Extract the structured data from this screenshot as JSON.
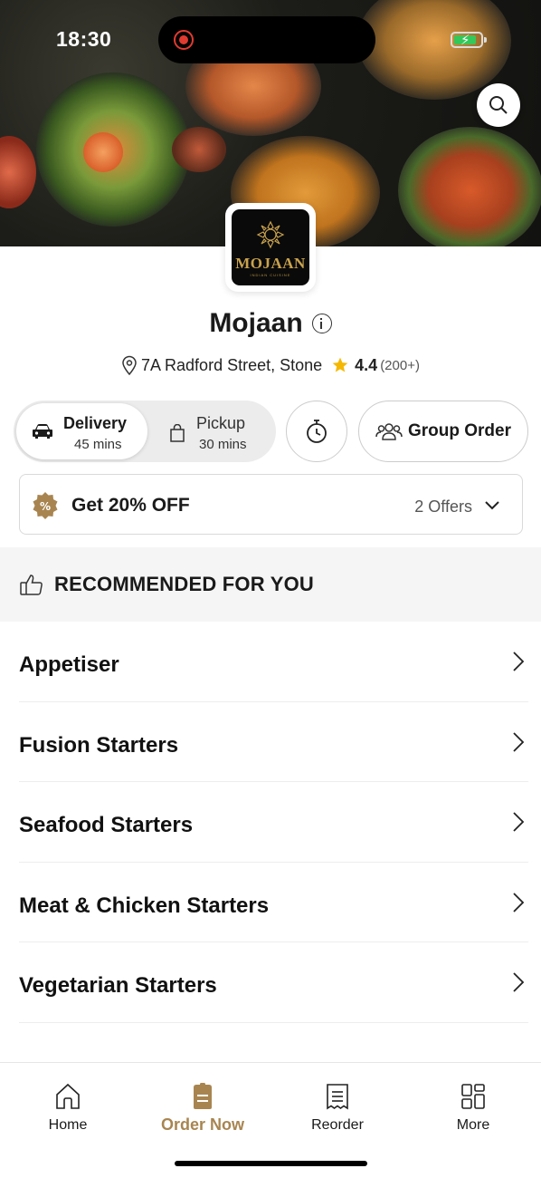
{
  "status_bar": {
    "time": "18:30",
    "battery_color": "#34c759",
    "battery_level": 0.85
  },
  "header": {
    "search_icon": "search-icon"
  },
  "restaurant": {
    "logo_text": "MOJAAN",
    "logo_subtext": "INDIAN CUISINE",
    "name": "Mojaan",
    "address": "7A Radford Street, Stone",
    "rating": "4.4",
    "reviews": "(200+)"
  },
  "order_mode": {
    "delivery_label": "Delivery",
    "delivery_time": "45 mins",
    "pickup_label": "Pickup",
    "pickup_time": "30 mins",
    "selected": "Delivery",
    "group_order_label": "Group Order"
  },
  "offers": {
    "title": "Get 20% OFF",
    "count": "2 Offers"
  },
  "recommended": {
    "title": "RECOMMENDED FOR YOU"
  },
  "categories": [
    {
      "label": "Appetiser"
    },
    {
      "label": "Fusion Starters"
    },
    {
      "label": "Seafood Starters"
    },
    {
      "label": "Meat & Chicken Starters"
    },
    {
      "label": "Vegetarian Starters"
    }
  ],
  "bottom_nav": [
    {
      "label": "Home",
      "icon": "home-icon"
    },
    {
      "label": "Order Now",
      "icon": "order-icon",
      "active": true
    },
    {
      "label": "Reorder",
      "icon": "receipt-icon"
    },
    {
      "label": "More",
      "icon": "grid-icon"
    }
  ],
  "colors": {
    "accent": "#a88550",
    "logo_gold": "#c9a24d",
    "star": "#f5b800",
    "text": "#1a1a1a"
  }
}
